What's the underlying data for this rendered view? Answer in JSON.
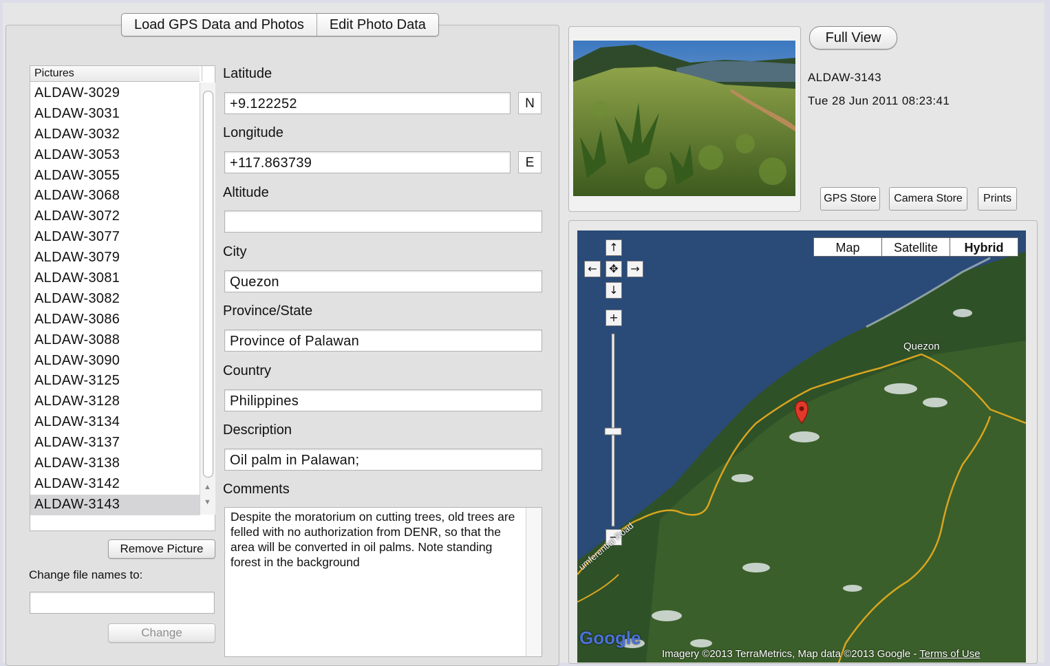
{
  "tabs": [
    "Load GPS Data and Photos",
    "Edit Photo Data"
  ],
  "pictures": {
    "header": "Pictures",
    "items": [
      "ALDAW-3029",
      "ALDAW-3031",
      "ALDAW-3032",
      "ALDAW-3053",
      "ALDAW-3055",
      "ALDAW-3068",
      "ALDAW-3072",
      "ALDAW-3077",
      "ALDAW-3079",
      "ALDAW-3081",
      "ALDAW-3082",
      "ALDAW-3086",
      "ALDAW-3088",
      "ALDAW-3090",
      "ALDAW-3125",
      "ALDAW-3128",
      "ALDAW-3134",
      "ALDAW-3137",
      "ALDAW-3138",
      "ALDAW-3142",
      "ALDAW-3143"
    ],
    "selected": "ALDAW-3143"
  },
  "left": {
    "remove_label": "Remove Picture",
    "change_names_label": "Change file names to:",
    "change_names_value": "",
    "change_label": "Change"
  },
  "form": {
    "latitude_label": "Latitude",
    "latitude_value": "+9.122252",
    "latitude_hemi": "N",
    "longitude_label": "Longitude",
    "longitude_value": "+117.863739",
    "longitude_hemi": "E",
    "altitude_label": "Altitude",
    "altitude_value": "",
    "city_label": "City",
    "city_value": "Quezon",
    "province_label": "Province/State",
    "province_value": "Province of Palawan",
    "country_label": "Country",
    "country_value": "Philippines",
    "description_label": "Description",
    "description_value": "Oil palm in Palawan;",
    "comments_label": "Comments",
    "comments_value": "Despite the moratorium on cutting trees, old trees are felled with no authorization from DENR, so that the area will be converted in oil palms. Note standing forest in the background"
  },
  "photo": {
    "full_view_label": "Full View",
    "name": "ALDAW-3143",
    "datetime": "Tue 28 Jun 2011 08:23:41",
    "gps_store_label": "GPS Store",
    "camera_store_label": "Camera Store",
    "prints_label": "Prints"
  },
  "map": {
    "types": [
      "Map",
      "Satellite",
      "Hybrid"
    ],
    "active_type": "Hybrid",
    "place_label": "Quezon",
    "road_label": "umferential Road",
    "google_label": "Google",
    "attribution": "Imagery ©2013 TerraMetrics, Map data ©2013 Google -",
    "terms_label": "Terms of Use"
  }
}
